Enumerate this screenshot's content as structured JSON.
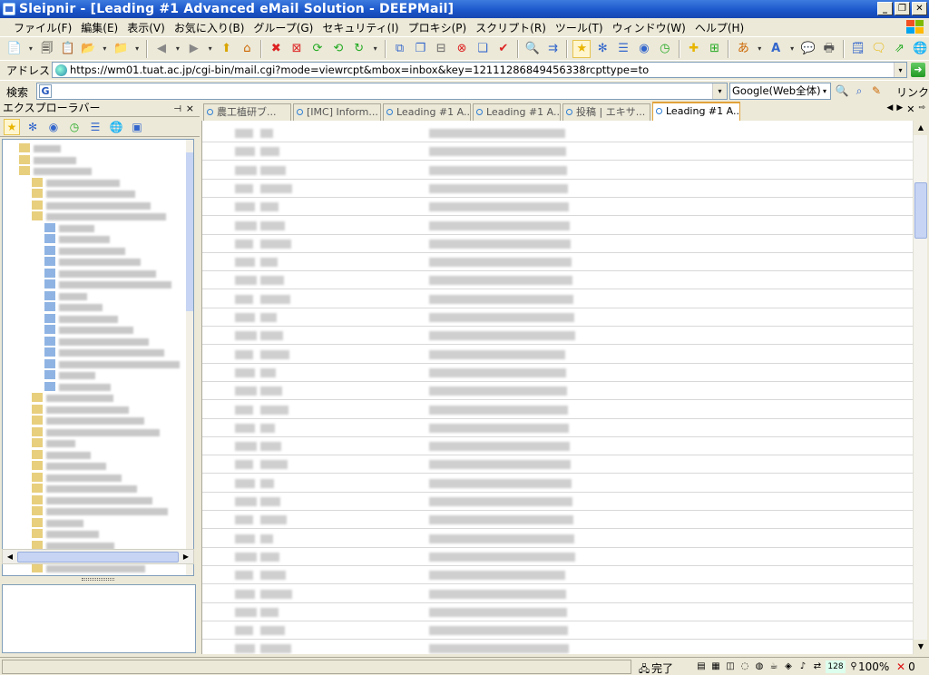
{
  "window": {
    "title": "Sleipnir - [Leading #1 Advanced eMail Solution - DEEPMail]",
    "buttons": [
      "_",
      "❐",
      "✕"
    ]
  },
  "menu": [
    "ファイル(F)",
    "編集(E)",
    "表示(V)",
    "お気に入り(B)",
    "グループ(G)",
    "セキュリティ(I)",
    "プロキシ(P)",
    "スクリプト(R)",
    "ツール(T)",
    "ウィンドウ(W)",
    "ヘルプ(H)"
  ],
  "address": {
    "label": "アドレス",
    "url": "https://wm01.tuat.ac.jp/cgi-bin/mail.cgi?mode=viewrcpt&mbox=inbox&key=12111286849456338rcpttype=to"
  },
  "search": {
    "label": "検索",
    "engine_letter": "G",
    "engine": "Google(Web全体)",
    "link_label": "リンク"
  },
  "explorer": {
    "title": "エクスプローラバー"
  },
  "tabs": [
    {
      "label": "農工植研ブ..."
    },
    {
      "label": "[IMC] Inform..."
    },
    {
      "label": "Leading #1 A..."
    },
    {
      "label": "Leading #1 A..."
    },
    {
      "label": "投稿 | エキサ..."
    },
    {
      "label": "Leading #1 A...",
      "active": true
    }
  ],
  "status": {
    "text": "完了",
    "badge": "128",
    "zoom": "100%",
    "errors": "0"
  },
  "colors": {
    "titlebar": "#1a55c9",
    "chrome": "#ece9d8",
    "active_tab_border": "#e2a23b",
    "scroll_thumb": "#c7d4f3"
  },
  "icons": {
    "toolbar": [
      "new-page-icon",
      "copy-page-icon",
      "open-icon",
      "open-folder-icon",
      "back-icon",
      "forward-icon",
      "up-icon",
      "home-icon",
      "stop-icon",
      "close-tab-icon",
      "reload-icon",
      "reload-all-icon",
      "new-window-icon",
      "close-x-icon",
      "duplicate-icon",
      "close-others-icon",
      "close-all-icon",
      "check-icon",
      "find-icon",
      "highlight-icon",
      "favorites-icon",
      "groups-icon",
      "tree-icon",
      "globe-icon",
      "history-icon",
      "add-favorite-icon",
      "add-page-icon",
      "encoding-icon",
      "font-icon",
      "chat-icon",
      "print-icon",
      "notes-icon",
      "message-icon",
      "send-icon",
      "web-icon"
    ]
  }
}
